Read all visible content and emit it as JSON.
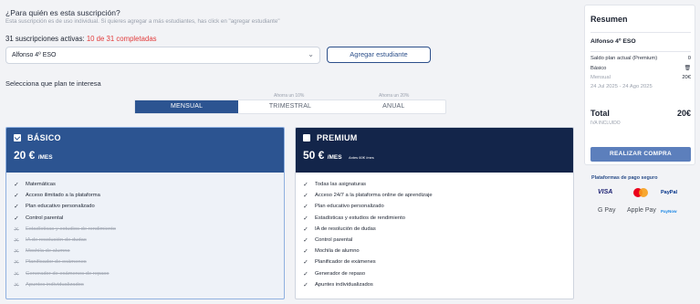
{
  "question": {
    "title": "¿Para quién es esta suscripción?",
    "subtitle": "Esta suscripción es de uso individual. Si quieres agregar a más estudiantes, has click en \"agregar estudiante\""
  },
  "subscriptions": {
    "prefix": "31 suscripciones activas:",
    "completed": "10 de 31 completadas"
  },
  "student_select": {
    "value": "Alfonso 4º ESO"
  },
  "add_student_label": "Agregar estudiante",
  "plan_question": "Selecciona que plan te interesa",
  "billing": {
    "options": [
      {
        "label": "MENSUAL",
        "note": ""
      },
      {
        "label": "TRIMESTRAL",
        "note": "Ahorra un 10%"
      },
      {
        "label": "ANUAL",
        "note": "Ahorra un 20%"
      }
    ],
    "selected": "MENSUAL"
  },
  "plans": {
    "basic": {
      "name": "BÁSICO",
      "price": "20 €",
      "period": "/MES",
      "features": [
        {
          "label": "Matemáticas",
          "included": true
        },
        {
          "label": "Acceso ilimitado a la plataforma",
          "included": true
        },
        {
          "label": "Plan educativo personalizado",
          "included": true
        },
        {
          "label": "Control parental",
          "included": true
        },
        {
          "label": "Estadísticas y estudios de rendimiento",
          "included": false
        },
        {
          "label": "IA de resolución de dudas",
          "included": false
        },
        {
          "label": "Mochila de alumno",
          "included": false
        },
        {
          "label": "Planificador de exámenes",
          "included": false
        },
        {
          "label": "Generador de exámenes de repaso",
          "included": false
        },
        {
          "label": "Apuntes individualizados",
          "included": false
        }
      ]
    },
    "premium": {
      "name": "PREMIUM",
      "price": "50 €",
      "period": "/MES",
      "before": "Antes 60€ /mes",
      "features": [
        {
          "label": "Todas las asignaturas",
          "included": true
        },
        {
          "label": "Acceso 24/7 a la plataforma online de aprendizaje",
          "included": true
        },
        {
          "label": "Plan educativo personalizado",
          "included": true
        },
        {
          "label": "Estadísticas y estudios de rendimiento",
          "included": true
        },
        {
          "label": "IA de resolución de dudas",
          "included": true
        },
        {
          "label": "Control parental",
          "included": true
        },
        {
          "label": "Mochila de alumno",
          "included": true
        },
        {
          "label": "Planificador de exámenes",
          "included": true
        },
        {
          "label": "Generador de repaso",
          "included": true
        },
        {
          "label": "Apuntes individualizados",
          "included": true
        }
      ]
    }
  },
  "summary": {
    "title": "Resumen",
    "student": "Alfonso 4º ESO",
    "balance_label": "Saldo plan actual (Premium)",
    "balance_value": "0",
    "plan_label": "Básico",
    "period_label": "Mensual",
    "period_value": "20€",
    "dates": "24 Jul 2025 - 24 Ago 2025",
    "total_label": "Total",
    "total_value": "20€",
    "tax_note": "IVA INCLUIDO",
    "buy_label": "REALIZAR COMPRA"
  },
  "payments": {
    "title": "Plataformas de pago seguro",
    "methods": [
      "VISA",
      "Mastercard",
      "PayPal",
      "G Pay",
      "Apple Pay",
      "PayNow"
    ]
  },
  "colors": {
    "accent": "#2c5491",
    "premium_header": "#13254a",
    "highlight_red": "#e23b3b",
    "buy_button": "#5c7fbc"
  }
}
